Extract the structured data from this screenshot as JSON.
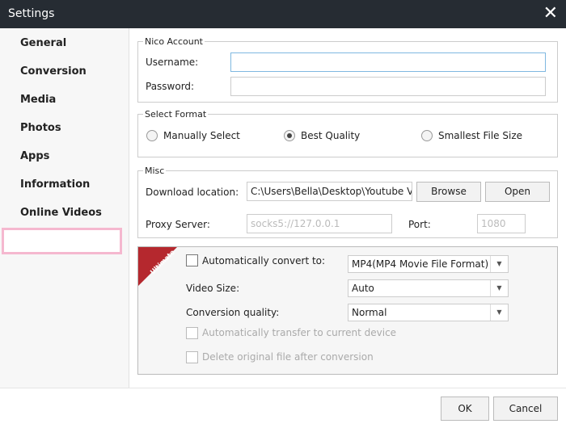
{
  "window": {
    "title": "Settings"
  },
  "sidebar": {
    "items": [
      {
        "label": "General"
      },
      {
        "label": "Conversion"
      },
      {
        "label": "Media"
      },
      {
        "label": "Photos"
      },
      {
        "label": "Apps"
      },
      {
        "label": "Information"
      },
      {
        "label": "Online Videos"
      }
    ],
    "selected": "Online Videos"
  },
  "nico": {
    "legend": "Nico Account",
    "username_label": "Username:",
    "username_value": "",
    "password_label": "Password:",
    "password_value": ""
  },
  "format": {
    "legend": "Select Format",
    "options": [
      {
        "label": "Manually Select",
        "checked": false
      },
      {
        "label": "Best Quality",
        "checked": true
      },
      {
        "label": "Smallest File Size",
        "checked": false
      }
    ]
  },
  "misc": {
    "legend": "Misc",
    "download_label": "Download location:",
    "download_value": "C:\\Users\\Bella\\Desktop\\Youtube Vide",
    "browse": "Browse",
    "open": "Open",
    "proxy_label": "Proxy Server:",
    "proxy_placeholder": "socks5://127.0.0.1",
    "port_label": "Port:",
    "port_placeholder": "1080"
  },
  "ultimate": {
    "badge": "Ultimate",
    "auto_convert_label": "Automatically convert to:",
    "auto_convert_checked": false,
    "format_value": "MP4(MP4 Movie File Format)",
    "video_size_label": "Video Size:",
    "video_size_value": "Auto",
    "quality_label": "Conversion quality:",
    "quality_value": "Normal",
    "transfer_label": "Automatically transfer to current device",
    "delete_label": "Delete original file after conversion"
  },
  "footer": {
    "ok": "OK",
    "cancel": "Cancel"
  },
  "colors": {
    "titlebar": "#262c33",
    "selected_border": "#f5b8cf",
    "badge": "#b5282e"
  }
}
